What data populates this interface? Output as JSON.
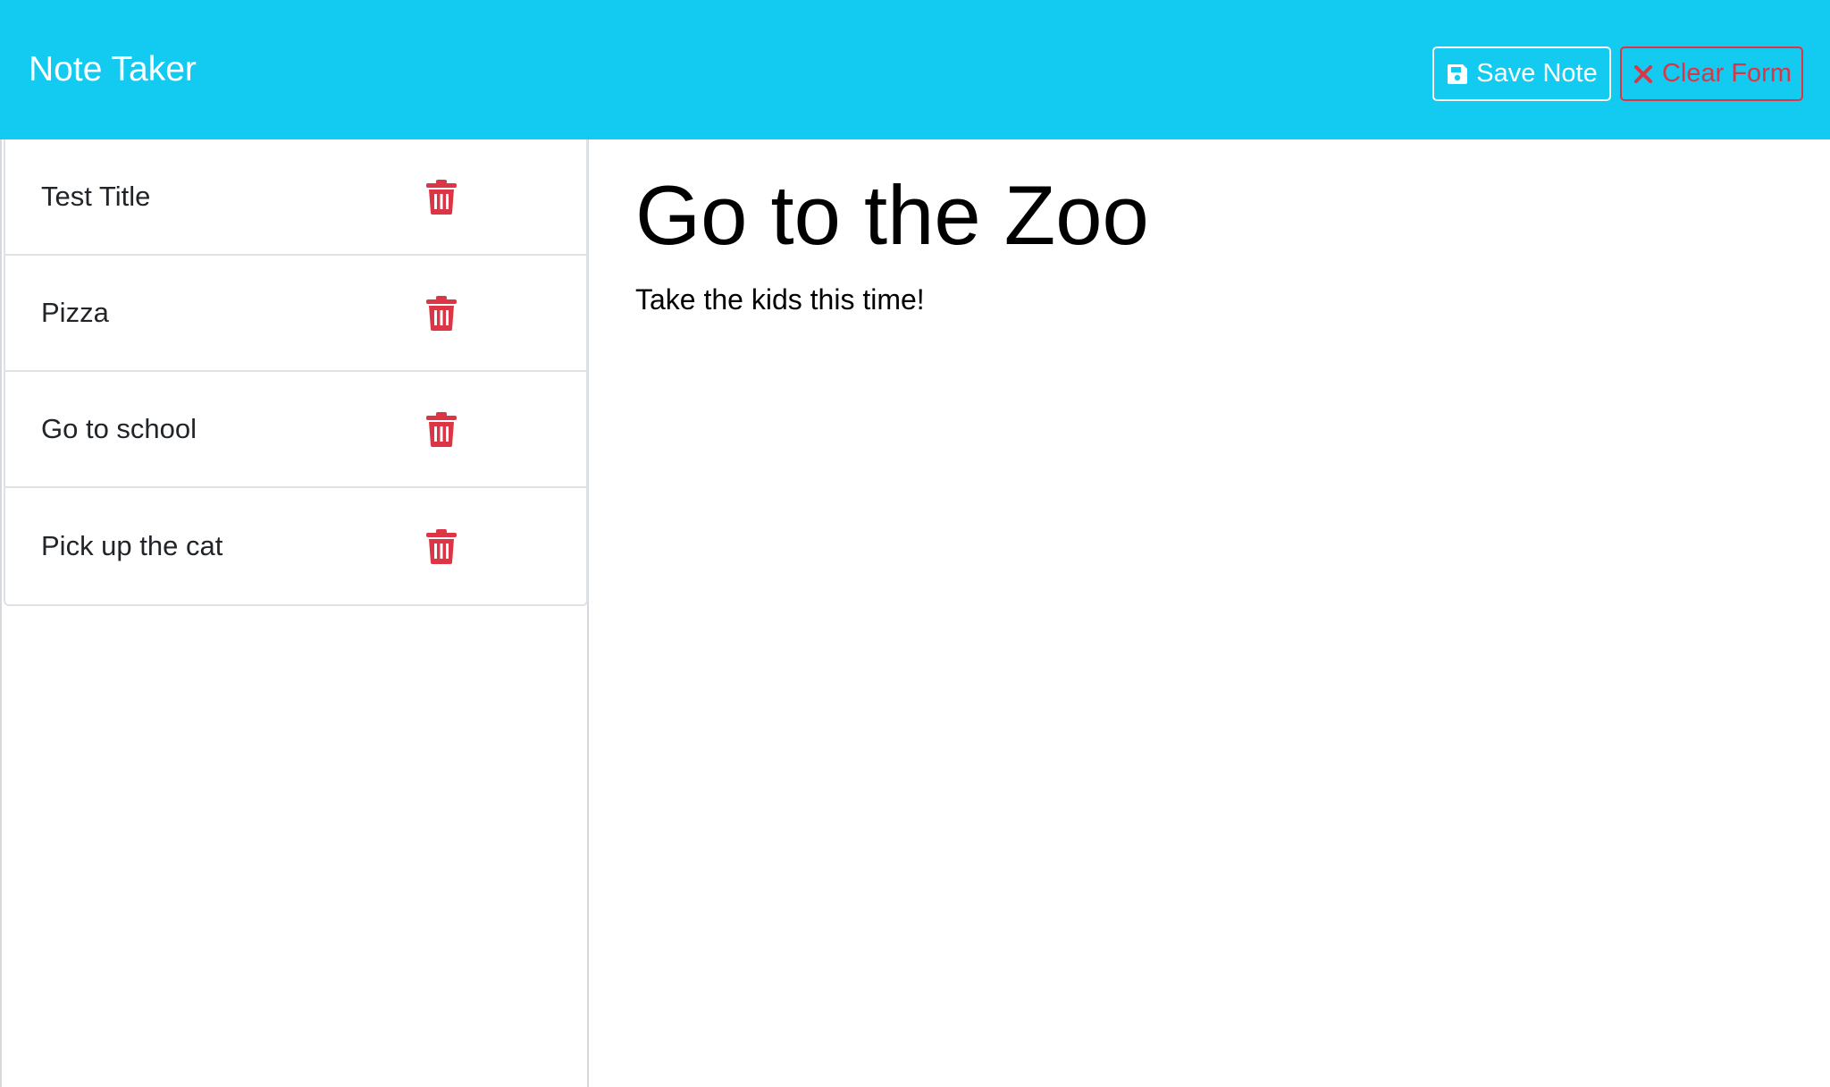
{
  "app": {
    "brand": "Note Taker"
  },
  "toolbar": {
    "save_label": "Save Note",
    "clear_label": "Clear Form"
  },
  "colors": {
    "navbar": "#13caf0",
    "danger": "#dc3545",
    "white": "#ffffff"
  },
  "icons": {
    "save": "floppy-disk-icon",
    "clear": "x-mark-icon",
    "delete": "trash-icon"
  },
  "notes": [
    {
      "title": "Test Title"
    },
    {
      "title": "Pizza"
    },
    {
      "title": "Go to school"
    },
    {
      "title": "Pick up the cat"
    }
  ],
  "active_note": {
    "title": "Go to the Zoo",
    "text": "Take the kids this time!"
  }
}
